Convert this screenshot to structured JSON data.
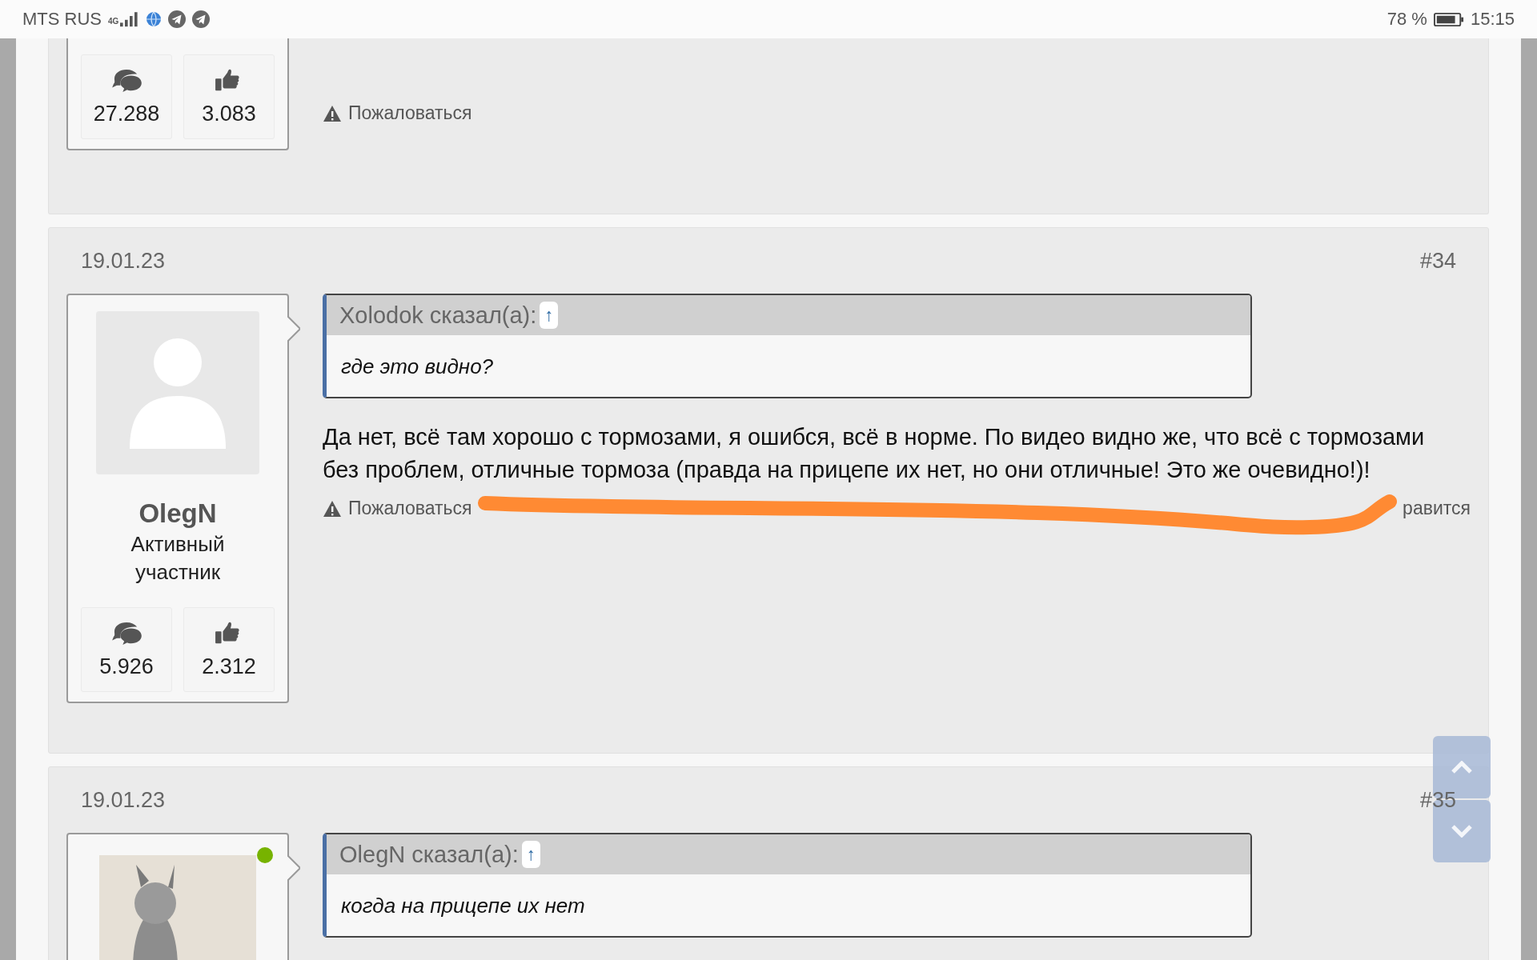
{
  "status_bar": {
    "carrier": "MTS RUS",
    "network": "4G",
    "battery": "78 %",
    "time": "15:15"
  },
  "posts": [
    {
      "partial": true,
      "stats": {
        "messages": "27.288",
        "likes": "3.083"
      },
      "report": "Пожаловаться"
    },
    {
      "partial": false,
      "date": "19.01.23",
      "number": "#34",
      "user": {
        "name": "OlegN",
        "role": "Активный участник",
        "online": false,
        "avatar": {
          "kind": "placeholder"
        }
      },
      "stats": {
        "messages": "5.926",
        "likes": "2.312"
      },
      "quote": {
        "author": "Xolodok сказал(а):",
        "arrow": "↑",
        "text": "где это видно?"
      },
      "message": "Да нет, всё там хорошо с тормозами, я ошибся, всё в норме. По видео видно же, что всё с тормозами без проблем, отличные тормоза (правда на прицепе их нет, но они отличные! Это же очевидно!)!",
      "report": "Пожаловаться",
      "like": "равится",
      "marked": true
    },
    {
      "partial": false,
      "date": "19.01.23",
      "number": "#35",
      "user": {
        "online": true
      },
      "quote": {
        "author": "OlegN сказал(а):",
        "arrow": "↑",
        "text": "когда на прицепе их нет"
      }
    }
  ]
}
